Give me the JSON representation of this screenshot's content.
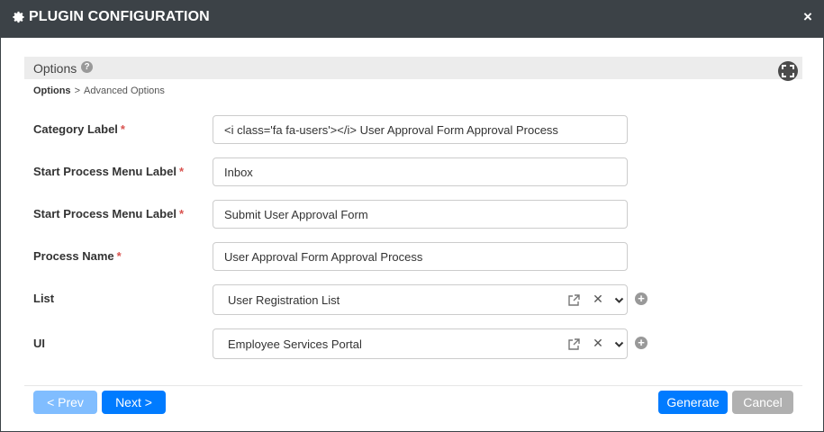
{
  "dialog": {
    "title": "PLUGIN CONFIGURATION",
    "close_glyph": "×",
    "title_icon": "gear-icon"
  },
  "options": {
    "header": "Options",
    "help_glyph": "?",
    "fullscreen_icon": "expand-icon"
  },
  "breadcrumb": {
    "current": "Options",
    "separator": ">",
    "next": "Advanced Options"
  },
  "fields": [
    {
      "label": "Category Label",
      "required": "*",
      "value": "<i class='fa fa-users'></i> User Approval Form Approval Process"
    },
    {
      "label": "Start Process Menu Label",
      "required": "*",
      "value": "Inbox"
    },
    {
      "label": "Start Process Menu Label",
      "required": "*",
      "value": "Submit User Approval Form"
    },
    {
      "label": "Process Name",
      "required": "*",
      "value": "User Approval Form Approval Process"
    }
  ],
  "selects": [
    {
      "label": "List",
      "value": "User Registration List"
    },
    {
      "label": "UI",
      "value": "Employee Services Portal"
    }
  ],
  "select_controls": {
    "clear_glyph": "✕",
    "add_glyph": "+"
  },
  "buttons": {
    "prev": "< Prev",
    "next": "Next >",
    "generate": "Generate",
    "cancel": "Cancel"
  },
  "colors": {
    "titlebar": "#3c4247",
    "primary": "#007bff",
    "primary_disabled": "#80bdff",
    "secondary_disabled": "#b0b0b0",
    "required": "#d9534f"
  }
}
